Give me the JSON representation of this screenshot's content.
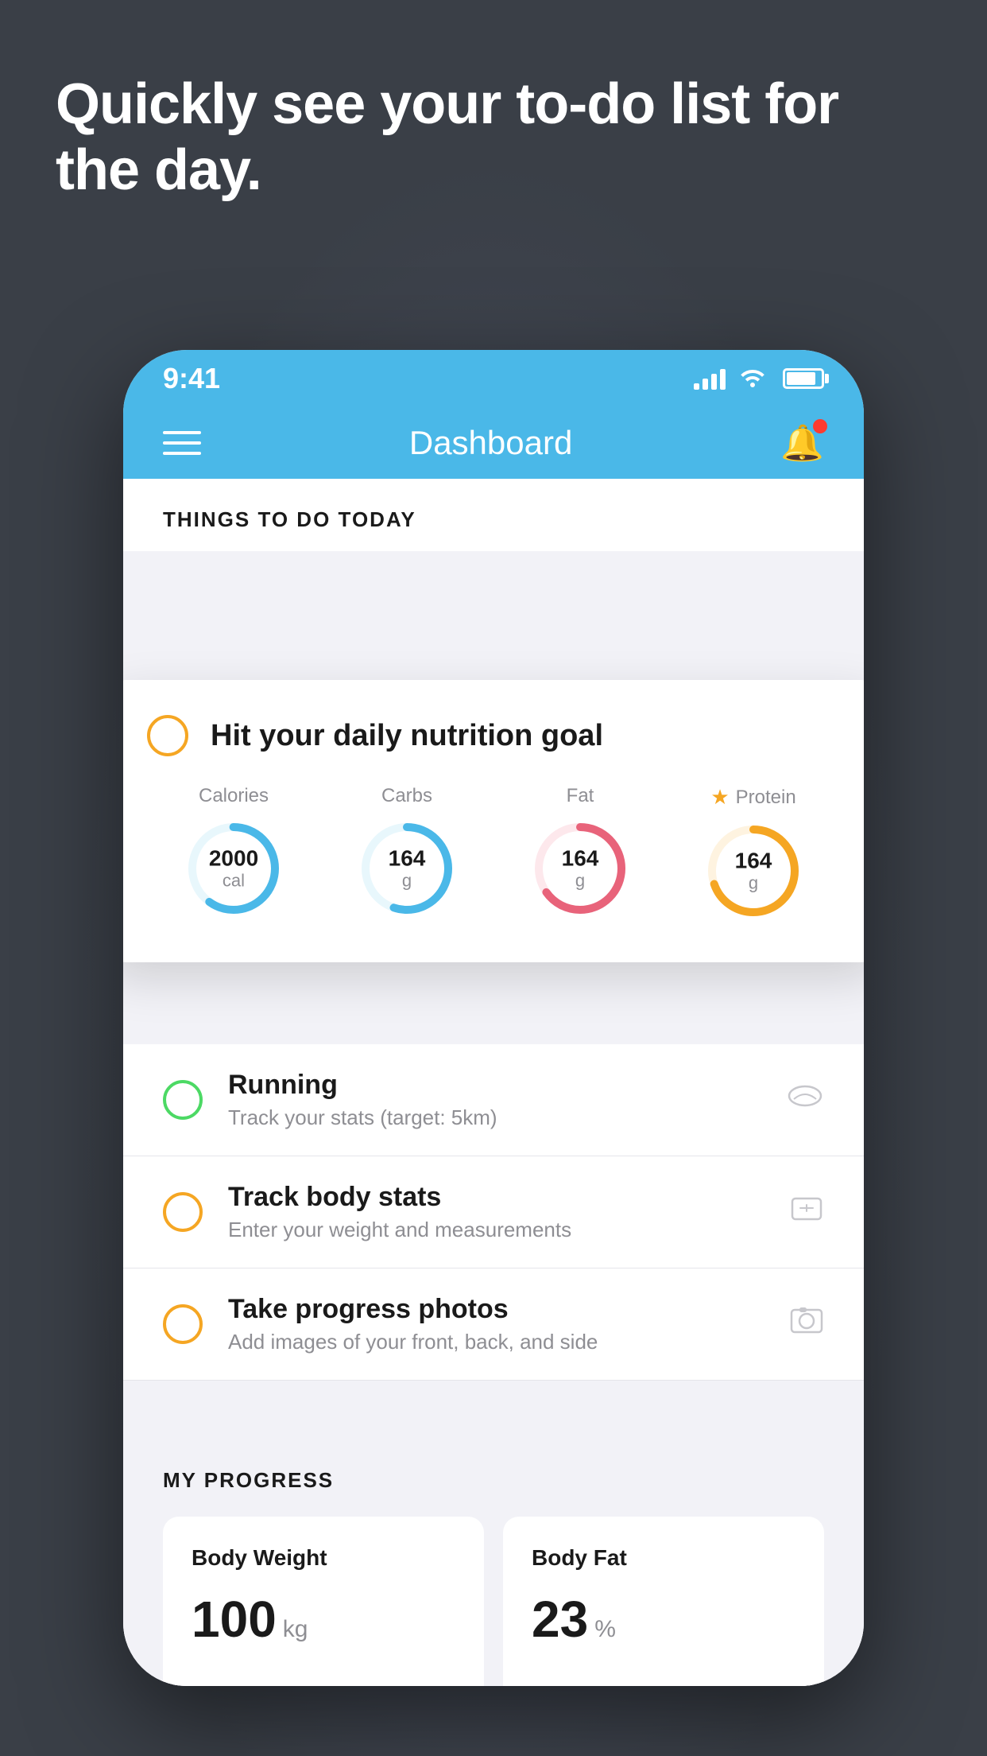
{
  "hero": {
    "title": "Quickly see your to-do list for the day."
  },
  "phone": {
    "statusBar": {
      "time": "9:41"
    },
    "navBar": {
      "title": "Dashboard"
    }
  },
  "thingsToDo": {
    "sectionTitle": "THINGS TO DO TODAY",
    "featuredCard": {
      "title": "Hit your daily nutrition goal",
      "nutrition": [
        {
          "label": "Calories",
          "value": "2000",
          "unit": "cal",
          "color": "#4ab8e8",
          "trackColor": "#e8f7fc",
          "percent": 60,
          "starred": false
        },
        {
          "label": "Carbs",
          "value": "164",
          "unit": "g",
          "color": "#4ab8e8",
          "trackColor": "#e8f7fc",
          "percent": 55,
          "starred": false
        },
        {
          "label": "Fat",
          "value": "164",
          "unit": "g",
          "color": "#e8637a",
          "trackColor": "#fde8ec",
          "percent": 65,
          "starred": false
        },
        {
          "label": "Protein",
          "value": "164",
          "unit": "g",
          "color": "#f5a623",
          "trackColor": "#fef3e0",
          "percent": 70,
          "starred": true
        }
      ]
    },
    "todoItems": [
      {
        "id": "running",
        "title": "Running",
        "subtitle": "Track your stats (target: 5km)",
        "circleType": "green",
        "icon": "shoe"
      },
      {
        "id": "body-stats",
        "title": "Track body stats",
        "subtitle": "Enter your weight and measurements",
        "circleType": "yellow",
        "icon": "scale"
      },
      {
        "id": "progress-photos",
        "title": "Take progress photos",
        "subtitle": "Add images of your front, back, and side",
        "circleType": "yellow",
        "icon": "photo"
      }
    ]
  },
  "myProgress": {
    "sectionTitle": "MY PROGRESS",
    "cards": [
      {
        "title": "Body Weight",
        "value": "100",
        "unit": "kg"
      },
      {
        "title": "Body Fat",
        "value": "23",
        "unit": "%"
      }
    ]
  }
}
